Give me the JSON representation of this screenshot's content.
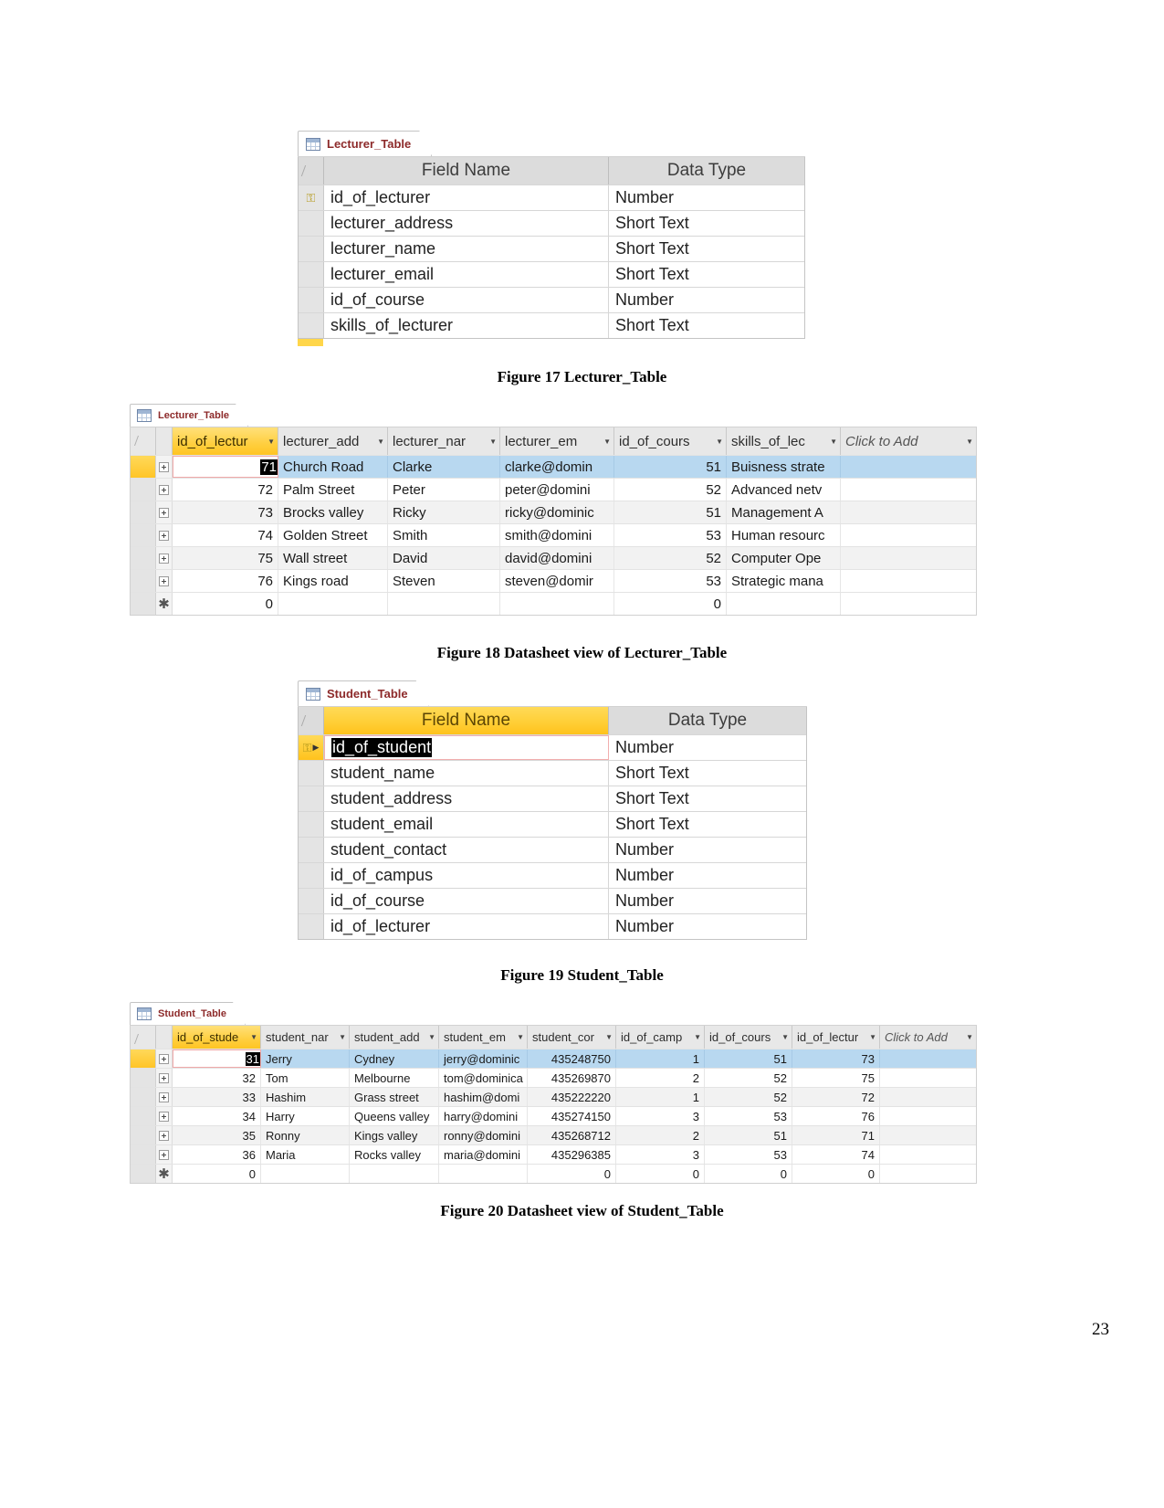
{
  "page": {
    "number": "23"
  },
  "figures": {
    "fig17": {
      "caption": "Figure 17 Lecturer_Table",
      "tab_label": "Lecturer_Table",
      "headers": {
        "field_name": "Field Name",
        "data_type": "Data Type"
      },
      "rows": [
        {
          "field": "id_of_lecturer",
          "type": "Number",
          "primary_key": true
        },
        {
          "field": "lecturer_address",
          "type": "Short Text",
          "primary_key": false
        },
        {
          "field": "lecturer_name",
          "type": "Short Text",
          "primary_key": false
        },
        {
          "field": "lecturer_email",
          "type": "Short Text",
          "primary_key": false
        },
        {
          "field": "id_of_course",
          "type": "Number",
          "primary_key": false
        },
        {
          "field": "skills_of_lecturer",
          "type": "Short Text",
          "primary_key": false
        }
      ]
    },
    "fig18": {
      "caption": "Figure 18 Datasheet view of Lecturer_Table",
      "tab_label": "Lecturer_Table",
      "add_column_label": "Click to Add",
      "columns": [
        "id_of_lectur",
        "lecturer_add",
        "lecturer_nar",
        "lecturer_em",
        "id_of_cours",
        "skills_of_lec"
      ],
      "rows": [
        {
          "id": "71",
          "address": "Church Road",
          "name": "Clarke",
          "email": "clarke@domin",
          "course": "51",
          "skills": "Buisness strate"
        },
        {
          "id": "72",
          "address": "Palm Street",
          "name": "Peter",
          "email": "peter@domini",
          "course": "52",
          "skills": "Advanced netv"
        },
        {
          "id": "73",
          "address": "Brocks valley",
          "name": "Ricky",
          "email": "ricky@dominic",
          "course": "51",
          "skills": "Management A"
        },
        {
          "id": "74",
          "address": "Golden Street",
          "name": "Smith",
          "email": "smith@domini",
          "course": "53",
          "skills": "Human resourc"
        },
        {
          "id": "75",
          "address": "Wall street",
          "name": "David",
          "email": "david@domini",
          "course": "52",
          "skills": "Computer Ope"
        },
        {
          "id": "76",
          "address": "Kings road",
          "name": "Steven",
          "email": "steven@domir",
          "course": "53",
          "skills": "Strategic mana"
        }
      ],
      "new_row": {
        "id": "0",
        "address": "",
        "name": "",
        "email": "",
        "course": "0",
        "skills": ""
      }
    },
    "fig19": {
      "caption": "Figure 19 Student_Table",
      "tab_label": "Student_Table",
      "headers": {
        "field_name": "Field Name",
        "data_type": "Data Type"
      },
      "rows": [
        {
          "field": "id_of_student",
          "type": "Number",
          "primary_key": true
        },
        {
          "field": "student_name",
          "type": "Short Text",
          "primary_key": false
        },
        {
          "field": "student_address",
          "type": "Short Text",
          "primary_key": false
        },
        {
          "field": "student_email",
          "type": "Short Text",
          "primary_key": false
        },
        {
          "field": "student_contact",
          "type": "Number",
          "primary_key": false
        },
        {
          "field": "id_of_campus",
          "type": "Number",
          "primary_key": false
        },
        {
          "field": "id_of_course",
          "type": "Number",
          "primary_key": false
        },
        {
          "field": "id_of_lecturer",
          "type": "Number",
          "primary_key": false
        }
      ]
    },
    "fig20": {
      "caption": "Figure 20 Datasheet view of Student_Table",
      "tab_label": "Student_Table",
      "add_column_label": "Click to Add",
      "columns": [
        "id_of_stude",
        "student_nar",
        "student_add",
        "student_em",
        "student_cor",
        "id_of_camp",
        "id_of_cours",
        "id_of_lectur"
      ],
      "rows": [
        {
          "id": "31",
          "name": "Jerry",
          "address": "Cydney",
          "email": "jerry@dominic",
          "contact": "435248750",
          "campus": "1",
          "course": "51",
          "lecturer": "73"
        },
        {
          "id": "32",
          "name": "Tom",
          "address": "Melbourne",
          "email": "tom@dominica",
          "contact": "435269870",
          "campus": "2",
          "course": "52",
          "lecturer": "75"
        },
        {
          "id": "33",
          "name": "Hashim",
          "address": "Grass street",
          "email": "hashim@domi",
          "contact": "435222220",
          "campus": "1",
          "course": "52",
          "lecturer": "72"
        },
        {
          "id": "34",
          "name": "Harry",
          "address": "Queens valley",
          "email": "harry@domini",
          "contact": "435274150",
          "campus": "3",
          "course": "53",
          "lecturer": "76"
        },
        {
          "id": "35",
          "name": "Ronny",
          "address": "Kings valley",
          "email": "ronny@domini",
          "contact": "435268712",
          "campus": "2",
          "course": "51",
          "lecturer": "71"
        },
        {
          "id": "36",
          "name": "Maria",
          "address": "Rocks valley",
          "email": "maria@domini",
          "contact": "435296385",
          "campus": "3",
          "course": "53",
          "lecturer": "74"
        }
      ],
      "new_row": {
        "id": "0",
        "name": "",
        "address": "",
        "email": "",
        "contact": "0",
        "campus": "0",
        "course": "0",
        "lecturer": "0"
      }
    }
  },
  "icons": {
    "table": "table-grid-icon",
    "key": "primary-key-icon",
    "expand": "expand-plus-icon",
    "new_record": "new-record-asterisk-icon",
    "dropdown": "chevron-down-icon"
  },
  "colors": {
    "tab_text": "#8d2a2a",
    "selection": "#b8d8f0",
    "highlight": "#ffc423"
  }
}
